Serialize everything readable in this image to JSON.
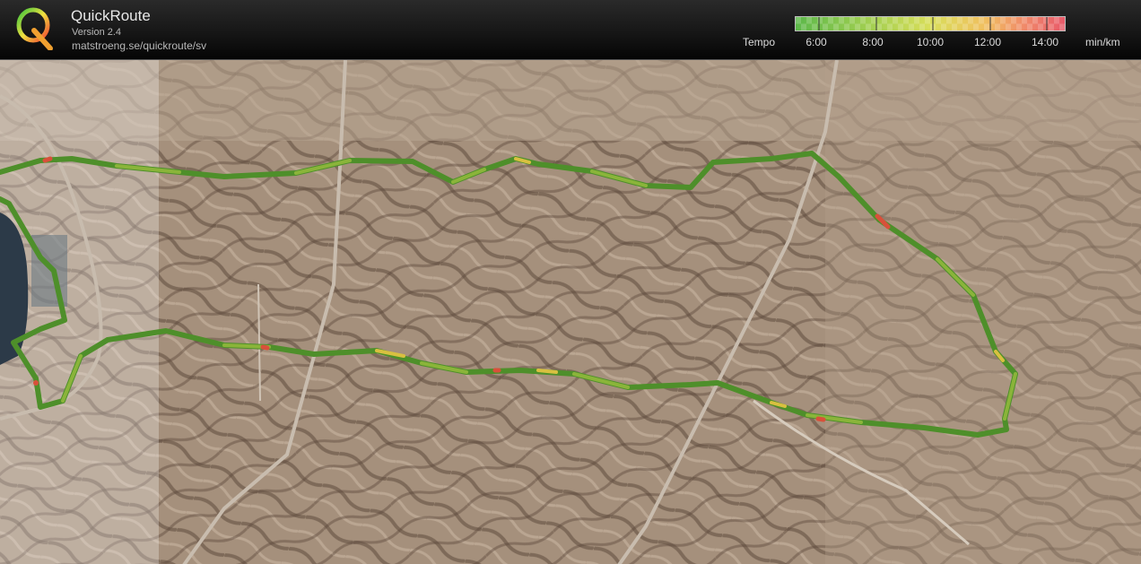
{
  "app": {
    "title": "QuickRoute",
    "version": "Version 2.4",
    "url": "matstroeng.se/quickroute/sv"
  },
  "legend": {
    "label": "Tempo",
    "unit": "min/km",
    "ticks": [
      "6:00",
      "8:00",
      "10:00",
      "12:00",
      "14:00"
    ],
    "colors": [
      "#5cb84a",
      "#9ccd50",
      "#d8de5a",
      "#f0c060",
      "#f08a6a",
      "#e85a6a"
    ]
  },
  "map": {
    "route_colors": {
      "fast": "#4e8f2a",
      "medium": "#8ab43a",
      "slow": "#d8c040",
      "slowest": "#d8503a"
    }
  }
}
